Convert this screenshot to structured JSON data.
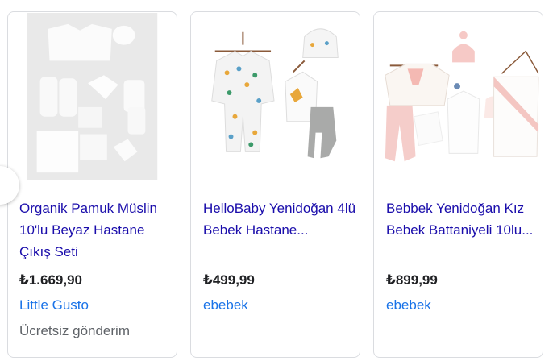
{
  "products": [
    {
      "title": "Organik Pamuk Müslin 10'lu Beyaz Hastane Çıkış Seti",
      "price": "₺1.669,90",
      "store": "Little Gusto",
      "shipping": "Ücretsiz gönderim"
    },
    {
      "title": "HelloBaby Yenidoğan 4lü Bebek Hastane...",
      "price": "₺499,99",
      "store": "ebebek"
    },
    {
      "title": "Bebbek Yenidoğan Kız Bebek Battaniyeli 10lu...",
      "price": "₺899,99",
      "store": "ebebek"
    }
  ],
  "colors": {
    "title_link": "#1a0dab",
    "store_link": "#1a73e8",
    "price": "#202124",
    "muted": "#5f6368",
    "border": "#dadce0"
  },
  "icons": {
    "prev_button": "carousel-prev-button"
  }
}
